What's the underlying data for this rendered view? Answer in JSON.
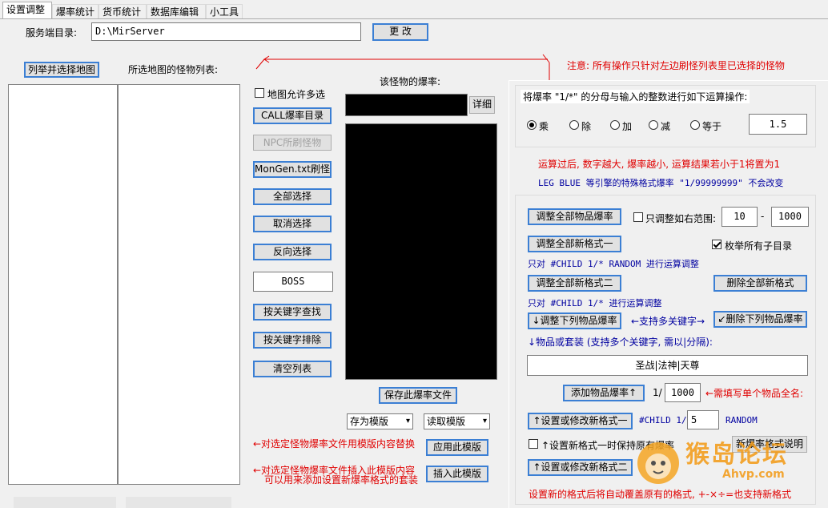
{
  "tabs": [
    "设置调整",
    "爆率统计",
    "货币统计",
    "数据库编辑",
    "小工具"
  ],
  "server_dir": {
    "label": "服务端目录:",
    "value": "D:\\MirServer",
    "change_button": "更  改"
  },
  "left": {
    "list_maps_button": "列举并选择地图",
    "monster_list_label": "所选地图的怪物列表:"
  },
  "middle": {
    "allow_multi_map": "地图允许多选",
    "buttons": [
      "CALL爆率目录",
      "NPC所刷怪物",
      "MonGen.txt刷怪",
      "全部选择",
      "取消选择",
      "反向选择"
    ],
    "boss_value": "BOSS",
    "search_buttons": [
      "按关键字查找",
      "按关键字排除",
      "清空列表"
    ]
  },
  "monster_rate": {
    "label": "该怪物的爆率:",
    "detail_button": "详细",
    "save_button": "保存此爆率文件",
    "save_as_template": "存为模版",
    "load_template": "读取模版",
    "apply_note": "←对选定怪物爆率文件用模版内容替换",
    "apply_button": "应用此模版",
    "insert_note_1": "←对选定怪物爆率文件插入此模版内容",
    "insert_note_2": "可以用来添加设置新爆率格式的套装",
    "insert_button": "插入此模版"
  },
  "notice": "注意: 所有操作只针对左边刷怪列表里已选择的怪物",
  "right": {
    "op_title": "将爆率 \"1/*\" 的分母与输入的整数进行如下运算操作:",
    "ops": [
      "乘",
      "除",
      "加",
      "减",
      "等于"
    ],
    "op_value": "1.5",
    "note_1": "运算过后, 数字越大, 爆率越小, 运算结果若小于1将置为1",
    "note_2": "LEG BLUE 等引擎的特殊格式爆率 \"1/99999999\" 不会改变",
    "adjust_all_button": "调整全部物品爆率",
    "range_label": "只调整如右范围:",
    "range_from": "10",
    "range_sep": "-",
    "range_to": "1000",
    "adjust_new1_button": "调整全部新格式一",
    "enum_subdirs": "枚举所有子目录",
    "hint_random": "只对 #CHILD 1/* RANDOM 进行运算调整",
    "adjust_new2_button": "调整全部新格式二",
    "delete_all_new_button": "删除全部新格式",
    "hint_child": "只对 #CHILD 1/* 进行运算调整",
    "adjust_listed_button": "↓调整下列物品爆率",
    "multi_keyword_hint": "←支持多关键字→",
    "delete_listed_button": "↙删除下列物品爆率",
    "items_label": "↓物品或套装 (支持多个关键字, 需以|分隔):",
    "items_value": "圣战|法神|天尊",
    "add_rate_button": "添加物品爆率↑",
    "add_rate_prefix": "1/",
    "add_rate_value": "1000",
    "add_rate_note": "←需填写单个物品全名:",
    "set_new1_button": "↑设置或修改新格式一",
    "child_prefix": "#CHILD 1/",
    "child_value": "5",
    "random_label": "RANDOM",
    "keep_label": "↑设置新格式一时保持原有爆率",
    "new_format_help_button": "新爆率格式说明",
    "set_new2_button": "↑设置或修改新格式二",
    "footer_note": "设置新的格式后将自动覆盖原有的格式, +-×÷=也支持新格式"
  },
  "watermark": {
    "text": "猴岛论坛",
    "url": "Ahvp.com"
  }
}
